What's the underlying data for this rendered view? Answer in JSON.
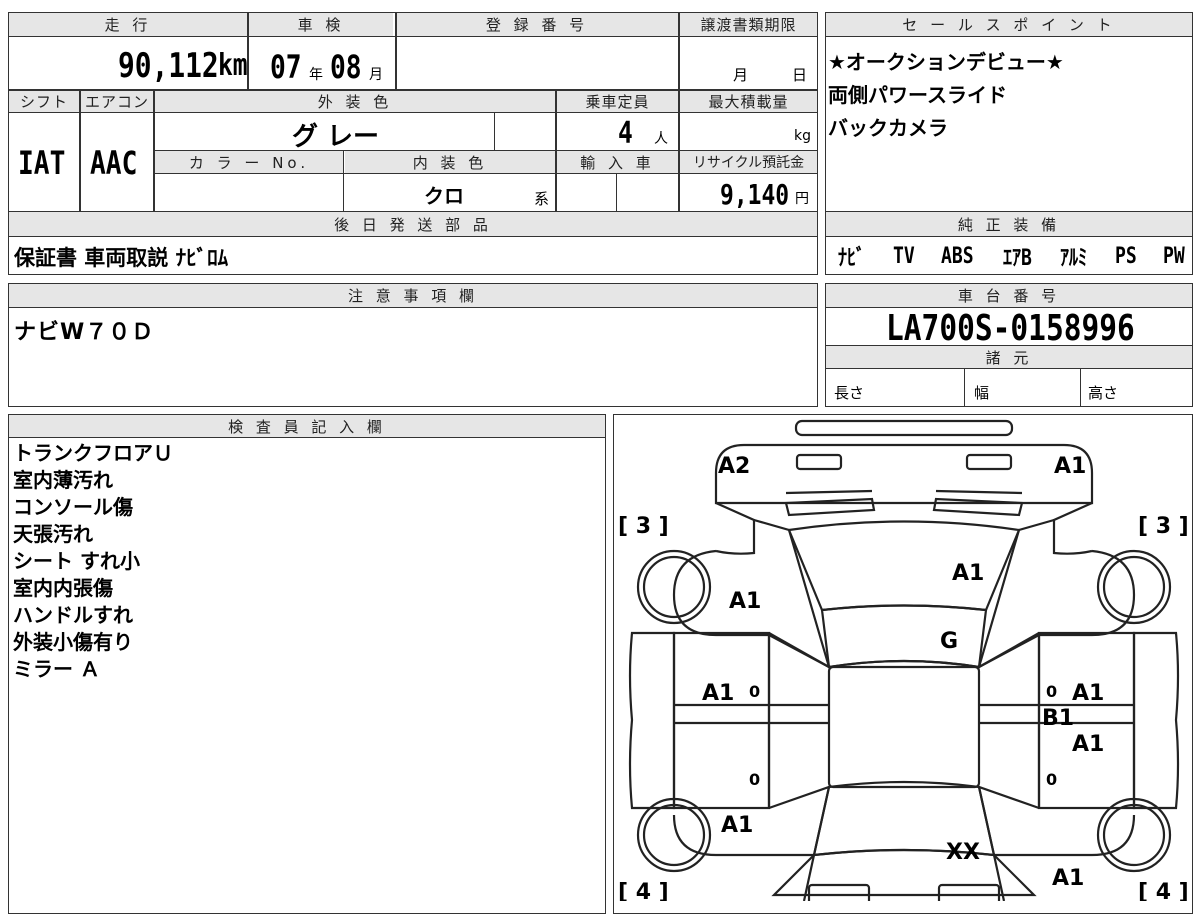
{
  "top_left": {
    "header_mileage": "走 行",
    "header_inspection": "車 検",
    "header_registration": "登 録 番 号",
    "header_transfer_deadline": "譲渡書類期限",
    "mileage_value": "90,112",
    "mileage_unit": "km",
    "inspection_year": "07",
    "year_unit": "年",
    "inspection_month": "08",
    "month_unit": "月",
    "deadline_month_label": "月",
    "deadline_day_label": "日",
    "header_shift": "シフト",
    "header_aircon": "エアコン",
    "header_exterior_color": "外 装 色",
    "header_capacity": "乗車定員",
    "header_max_load": "最大積載量",
    "shift_value": "IAT",
    "aircon_value": "AAC",
    "exterior_color_value": "グ レー",
    "capacity_value": "4",
    "capacity_unit": "人",
    "max_load_unit": "kg",
    "header_color_no": "カ ラ ー No.",
    "header_interior_color": "内 装 色",
    "header_import": "輸 入 車",
    "header_recycle": "リサイクル預託金",
    "interior_color_value": "クロ",
    "interior_color_suffix": "系",
    "recycle_value": "9,140",
    "recycle_unit": "円",
    "header_later_parts": "後 日 発 送 部 品",
    "later_parts_value": "保証書 車両取説 ﾅﾋﾞﾛﾑ"
  },
  "sales_points": {
    "header": "セ ー ル ス ポ イ ン ト",
    "lines": [
      "★オークションデビュー★",
      "両側パワースライド",
      "バックカメラ"
    ]
  },
  "genuine_equipment": {
    "header": "純 正 装 備",
    "items": [
      "ﾅﾋﾞ",
      "TV",
      "ABS",
      "ｴｱB",
      "ｱﾙﾐ",
      "PS",
      "PW"
    ]
  },
  "notes": {
    "header": "注 意 事 項 欄",
    "value": "ナビW７０Ｄ"
  },
  "chassis": {
    "header": "車 台 番 号",
    "value": "LA700S-0158996",
    "specs_header": "諸 元",
    "length_label": "長さ",
    "width_label": "幅",
    "height_label": "高さ"
  },
  "inspector": {
    "header": "検 査 員 記 入 欄",
    "lines": [
      "トランクフロアＵ",
      "室内薄汚れ",
      "コンソール傷",
      "天張汚れ",
      "シート すれ小",
      "室内内張傷",
      "ハンドルすれ",
      "外装小傷有り",
      "ミラー Ａ"
    ]
  },
  "diagram": {
    "marks": {
      "rear_left": "A2",
      "rear_right": "A1",
      "rear_left_rating": "[ 3 ]",
      "rear_right_rating": "[ 3 ]",
      "roof": "A1",
      "left_rear_quarter": "A1",
      "glass": "G",
      "left_door": "A1",
      "right_door_a": "A1",
      "right_door_b": "B1",
      "right_door_c": "A1",
      "left_front_fender": "A1",
      "hood": "XX",
      "right_front": "A1",
      "front_left_rating": "[ 4 ]",
      "front_right_rating": "[ 4 ]",
      "zero_1": "0",
      "zero_2": "0",
      "zero_3": "0",
      "zero_4": "0"
    }
  }
}
